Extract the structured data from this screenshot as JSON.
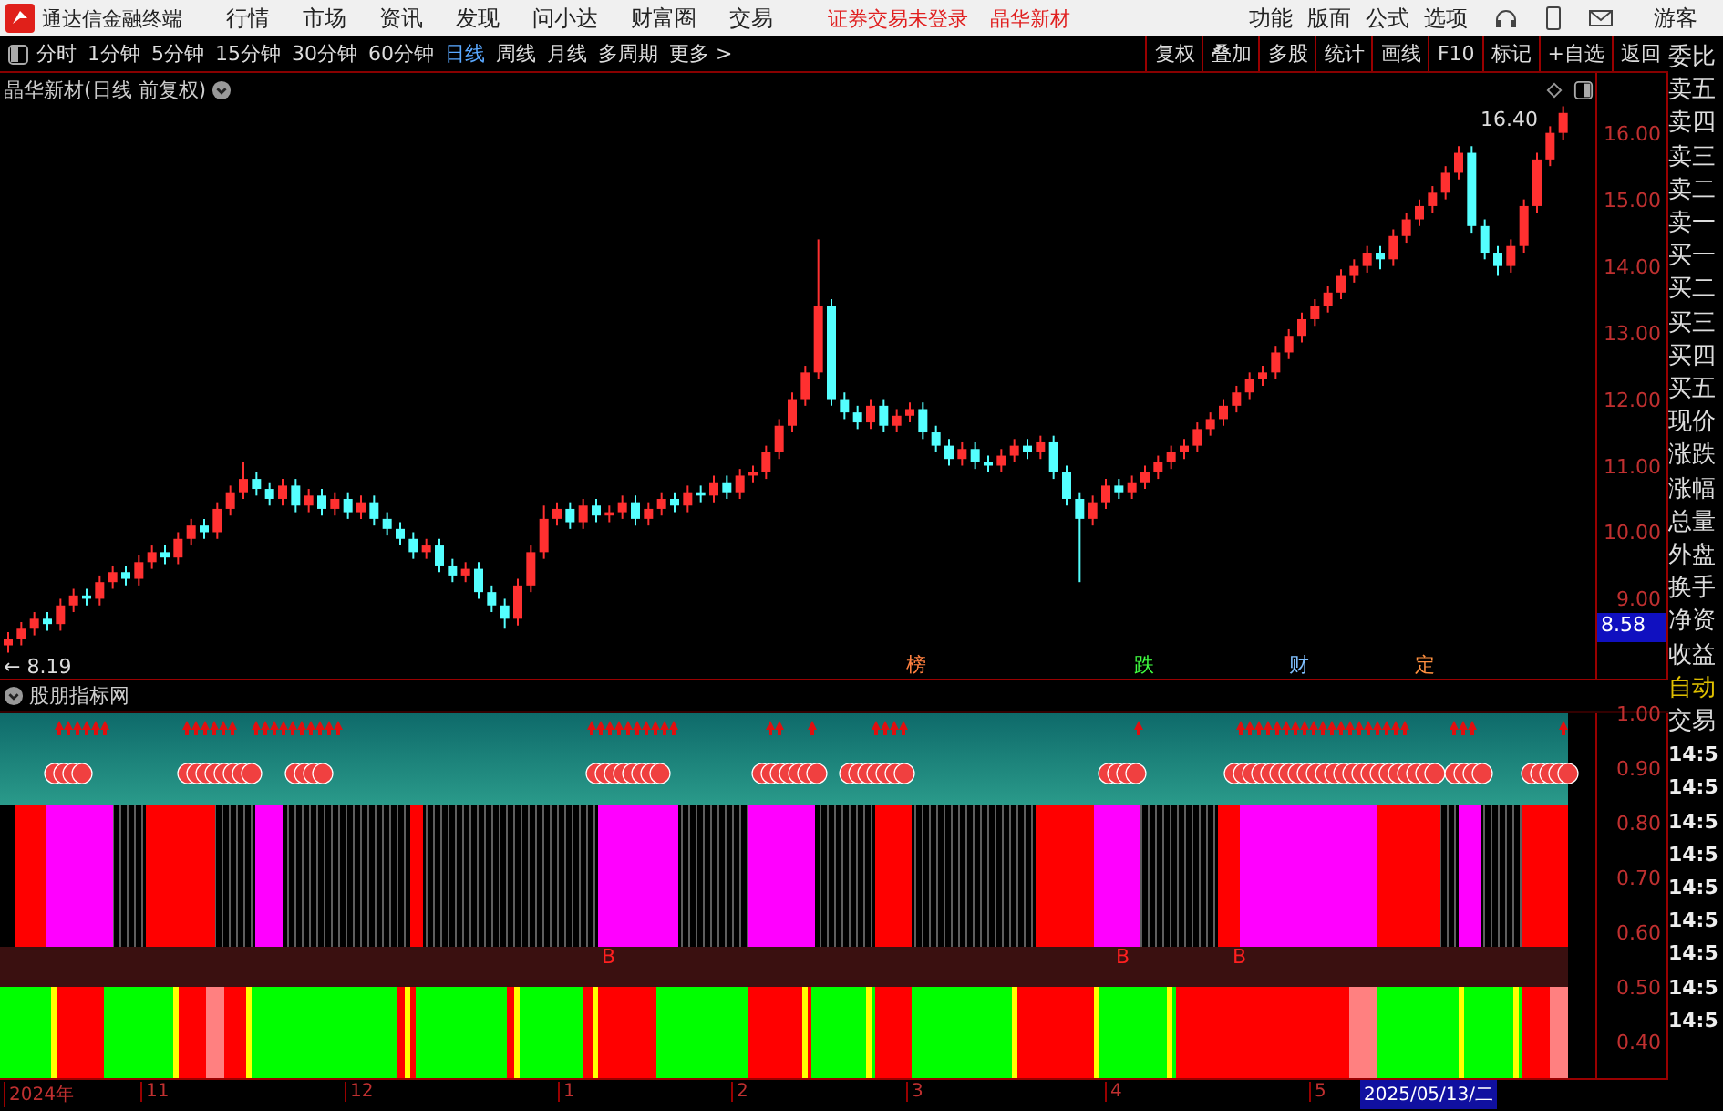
{
  "menu_bar": {
    "app_title": "通达信金融终端",
    "items": [
      "行情",
      "市场",
      "资讯",
      "发现",
      "问小达",
      "财富圈",
      "交易"
    ],
    "login_notice": "证券交易未登录",
    "stock_name": "晶华新材",
    "right_items": [
      "功能",
      "版面",
      "公式",
      "选项"
    ],
    "user": "游客"
  },
  "toolbar": {
    "periods": [
      {
        "label": "分时",
        "selected": false
      },
      {
        "label": "1分钟",
        "selected": false
      },
      {
        "label": "5分钟",
        "selected": false
      },
      {
        "label": "15分钟",
        "selected": false
      },
      {
        "label": "30分钟",
        "selected": false
      },
      {
        "label": "60分钟",
        "selected": false
      },
      {
        "label": "日线",
        "selected": true
      },
      {
        "label": "周线",
        "selected": false
      },
      {
        "label": "月线",
        "selected": false
      },
      {
        "label": "多周期",
        "selected": false
      },
      {
        "label": "更多 >",
        "selected": false
      }
    ],
    "buttons": [
      "复权",
      "叠加",
      "多股",
      "统计",
      "画线",
      "F10",
      "标记",
      "+自选",
      "返回"
    ]
  },
  "main_chart": {
    "title": "晶华新材(日线 前复权)",
    "high_label": "16.40",
    "low_label": "← 8.19",
    "cursor_value": "8.58",
    "chart_data": {
      "type": "candlestick",
      "ylim": [
        7.8,
        16.9
      ],
      "yticks": [
        {
          "value": 16,
          "label": "16.00"
        },
        {
          "value": 15,
          "label": "15.00"
        },
        {
          "value": 14,
          "label": "14.00"
        },
        {
          "value": 13,
          "label": "13.00"
        },
        {
          "value": 12,
          "label": "12.00"
        },
        {
          "value": 11,
          "label": "11.00"
        },
        {
          "value": 10,
          "label": "10.00"
        },
        {
          "value": 9,
          "label": "9.00"
        }
      ],
      "categories": [
        null,
        null,
        null,
        null,
        null,
        null,
        null,
        null,
        null,
        null,
        null,
        null,
        null,
        null,
        null,
        null,
        null,
        null,
        null,
        null,
        null,
        null,
        null,
        null,
        null,
        null,
        null,
        null,
        null,
        null,
        null,
        null,
        null,
        null,
        null,
        null,
        null,
        null,
        null,
        null,
        null,
        null,
        null,
        null,
        null,
        null,
        null,
        null,
        null,
        null,
        null,
        null,
        null,
        null,
        null,
        null,
        null,
        null,
        null,
        null,
        null,
        null,
        null,
        null,
        null,
        null,
        null,
        null,
        null,
        null,
        null,
        null,
        null,
        null,
        null,
        null,
        null,
        null,
        null,
        null,
        null,
        null,
        null,
        null,
        null,
        null,
        null,
        null,
        null,
        null,
        null,
        null,
        null,
        null,
        null,
        null,
        null,
        null,
        null,
        null,
        null,
        null,
        null,
        null,
        null,
        null,
        null,
        null,
        null,
        null,
        null,
        null,
        null,
        null,
        null,
        null,
        null,
        null,
        null,
        null
      ],
      "ohlc": [
        [
          8.3,
          8.5,
          8.19,
          8.4
        ],
        [
          8.4,
          8.65,
          8.3,
          8.55
        ],
        [
          8.55,
          8.8,
          8.45,
          8.7
        ],
        [
          8.7,
          8.8,
          8.52,
          8.62
        ],
        [
          8.62,
          9.0,
          8.52,
          8.9
        ],
        [
          8.9,
          9.15,
          8.8,
          9.05
        ],
        [
          9.05,
          9.15,
          8.9,
          9.0
        ],
        [
          9.0,
          9.35,
          8.9,
          9.25
        ],
        [
          9.25,
          9.5,
          9.15,
          9.4
        ],
        [
          9.4,
          9.5,
          9.2,
          9.3
        ],
        [
          9.3,
          9.65,
          9.2,
          9.55
        ],
        [
          9.55,
          9.8,
          9.45,
          9.7
        ],
        [
          9.7,
          9.8,
          9.52,
          9.62
        ],
        [
          9.62,
          10.0,
          9.52,
          9.9
        ],
        [
          9.9,
          10.2,
          9.8,
          10.1
        ],
        [
          10.1,
          10.2,
          9.9,
          10.0
        ],
        [
          10.0,
          10.45,
          9.9,
          10.35
        ],
        [
          10.35,
          10.7,
          10.25,
          10.6
        ],
        [
          10.6,
          11.05,
          10.5,
          10.8
        ],
        [
          10.8,
          10.9,
          10.55,
          10.65
        ],
        [
          10.65,
          10.75,
          10.4,
          10.5
        ],
        [
          10.5,
          10.8,
          10.4,
          10.7
        ],
        [
          10.7,
          10.8,
          10.3,
          10.4
        ],
        [
          10.4,
          10.65,
          10.3,
          10.55
        ],
        [
          10.55,
          10.65,
          10.25,
          10.35
        ],
        [
          10.35,
          10.6,
          10.25,
          10.5
        ],
        [
          10.5,
          10.6,
          10.2,
          10.3
        ],
        [
          10.3,
          10.55,
          10.2,
          10.45
        ],
        [
          10.45,
          10.55,
          10.1,
          10.2
        ],
        [
          10.2,
          10.3,
          9.95,
          10.05
        ],
        [
          10.05,
          10.15,
          9.8,
          9.9
        ],
        [
          9.9,
          10.0,
          9.6,
          9.7
        ],
        [
          9.7,
          9.9,
          9.6,
          9.8
        ],
        [
          9.8,
          9.9,
          9.4,
          9.5
        ],
        [
          9.5,
          9.6,
          9.25,
          9.35
        ],
        [
          9.35,
          9.55,
          9.25,
          9.45
        ],
        [
          9.45,
          9.55,
          9.0,
          9.1
        ],
        [
          9.1,
          9.2,
          8.8,
          8.9
        ],
        [
          8.9,
          9.0,
          8.55,
          8.7
        ],
        [
          8.7,
          9.3,
          8.6,
          9.2
        ],
        [
          9.2,
          9.8,
          9.1,
          9.7
        ],
        [
          9.7,
          10.4,
          9.6,
          10.2
        ],
        [
          10.2,
          10.45,
          10.1,
          10.35
        ],
        [
          10.35,
          10.45,
          10.05,
          10.15
        ],
        [
          10.15,
          10.5,
          10.05,
          10.4
        ],
        [
          10.4,
          10.5,
          10.15,
          10.25
        ],
        [
          10.25,
          10.4,
          10.15,
          10.3
        ],
        [
          10.3,
          10.55,
          10.2,
          10.45
        ],
        [
          10.45,
          10.55,
          10.1,
          10.2
        ],
        [
          10.2,
          10.45,
          10.1,
          10.35
        ],
        [
          10.35,
          10.6,
          10.25,
          10.5
        ],
        [
          10.5,
          10.6,
          10.3,
          10.4
        ],
        [
          10.4,
          10.7,
          10.3,
          10.6
        ],
        [
          10.6,
          10.7,
          10.45,
          10.55
        ],
        [
          10.55,
          10.85,
          10.45,
          10.75
        ],
        [
          10.75,
          10.85,
          10.5,
          10.6
        ],
        [
          10.6,
          10.95,
          10.5,
          10.85
        ],
        [
          10.85,
          11.0,
          10.75,
          10.9
        ],
        [
          10.9,
          11.3,
          10.8,
          11.2
        ],
        [
          11.2,
          11.7,
          11.1,
          11.6
        ],
        [
          11.6,
          12.1,
          11.5,
          12.0
        ],
        [
          12.0,
          12.5,
          11.9,
          12.4
        ],
        [
          12.4,
          14.4,
          12.3,
          13.4
        ],
        [
          13.4,
          13.5,
          11.9,
          12.0
        ],
        [
          12.0,
          12.1,
          11.7,
          11.8
        ],
        [
          11.8,
          11.9,
          11.55,
          11.65
        ],
        [
          11.65,
          12.0,
          11.55,
          11.9
        ],
        [
          11.9,
          12.0,
          11.5,
          11.6
        ],
        [
          11.6,
          11.85,
          11.5,
          11.75
        ],
        [
          11.75,
          11.95,
          11.65,
          11.85
        ],
        [
          11.85,
          11.95,
          11.4,
          11.5
        ],
        [
          11.5,
          11.6,
          11.2,
          11.3
        ],
        [
          11.3,
          11.4,
          11.0,
          11.1
        ],
        [
          11.1,
          11.35,
          11.0,
          11.25
        ],
        [
          11.25,
          11.35,
          10.95,
          11.05
        ],
        [
          11.05,
          11.15,
          10.9,
          11.0
        ],
        [
          11.0,
          11.25,
          10.9,
          11.15
        ],
        [
          11.15,
          11.4,
          11.05,
          11.3
        ],
        [
          11.3,
          11.4,
          11.1,
          11.2
        ],
        [
          11.2,
          11.45,
          11.1,
          11.35
        ],
        [
          11.35,
          11.45,
          10.8,
          10.9
        ],
        [
          10.9,
          11.0,
          10.4,
          10.5
        ],
        [
          10.5,
          10.6,
          9.25,
          10.2
        ],
        [
          10.2,
          10.55,
          10.1,
          10.45
        ],
        [
          10.45,
          10.8,
          10.35,
          10.7
        ],
        [
          10.7,
          10.8,
          10.5,
          10.6
        ],
        [
          10.6,
          10.85,
          10.5,
          10.75
        ],
        [
          10.75,
          11.0,
          10.65,
          10.9
        ],
        [
          10.9,
          11.15,
          10.8,
          11.05
        ],
        [
          11.05,
          11.3,
          10.95,
          11.2
        ],
        [
          11.2,
          11.4,
          11.1,
          11.3
        ],
        [
          11.3,
          11.65,
          11.2,
          11.55
        ],
        [
          11.55,
          11.8,
          11.45,
          11.7
        ],
        [
          11.7,
          12.0,
          11.6,
          11.9
        ],
        [
          11.9,
          12.2,
          11.8,
          12.1
        ],
        [
          12.1,
          12.4,
          12.0,
          12.3
        ],
        [
          12.3,
          12.5,
          12.2,
          12.4
        ],
        [
          12.4,
          12.8,
          12.3,
          12.7
        ],
        [
          12.7,
          13.05,
          12.6,
          12.95
        ],
        [
          12.95,
          13.3,
          12.85,
          13.2
        ],
        [
          13.2,
          13.5,
          13.1,
          13.4
        ],
        [
          13.4,
          13.7,
          13.3,
          13.6
        ],
        [
          13.6,
          13.95,
          13.5,
          13.85
        ],
        [
          13.85,
          14.1,
          13.75,
          14.0
        ],
        [
          14.0,
          14.3,
          13.9,
          14.2
        ],
        [
          14.2,
          14.3,
          13.95,
          14.1
        ],
        [
          14.1,
          14.55,
          14.0,
          14.45
        ],
        [
          14.45,
          14.8,
          14.35,
          14.7
        ],
        [
          14.7,
          15.0,
          14.6,
          14.9
        ],
        [
          14.9,
          15.2,
          14.8,
          15.1
        ],
        [
          15.1,
          15.5,
          15.0,
          15.4
        ],
        [
          15.4,
          15.8,
          15.3,
          15.7
        ],
        [
          15.7,
          15.8,
          14.5,
          14.6
        ],
        [
          14.6,
          14.7,
          14.1,
          14.2
        ],
        [
          14.2,
          14.3,
          13.85,
          14.0
        ],
        [
          14.0,
          14.4,
          13.9,
          14.3
        ],
        [
          14.3,
          15.0,
          14.2,
          14.9
        ],
        [
          14.9,
          15.7,
          14.8,
          15.6
        ],
        [
          15.6,
          16.1,
          15.5,
          16.0
        ],
        [
          16.0,
          16.4,
          15.9,
          16.3
        ]
      ]
    },
    "event_marks": [
      {
        "text": "榜",
        "color": "#ff8040"
      },
      {
        "text": "跌",
        "color": "#40ff40"
      },
      {
        "text": "财",
        "color": "#80c0ff"
      },
      {
        "text": "定",
        "color": "#ff9040"
      }
    ]
  },
  "indicator": {
    "title": "股朋指标网",
    "yticks": [
      "1.00",
      "0.90",
      "0.80",
      "0.70",
      "0.60",
      "0.50",
      "0.40"
    ],
    "b_marks": [
      "B",
      "B",
      "B"
    ]
  },
  "date_axis": [
    "2024年",
    "11",
    "12",
    "1",
    "2",
    "3",
    "4",
    "5"
  ],
  "date_cursor": "2025/05/13/二",
  "right_panel": [
    {
      "label": "委比",
      "kind": "label"
    },
    {
      "label": "卖五",
      "kind": "label"
    },
    {
      "label": "卖四",
      "kind": "label"
    },
    {
      "label": "卖三",
      "kind": "label"
    },
    {
      "label": "卖二",
      "kind": "label"
    },
    {
      "label": "卖一",
      "kind": "label"
    },
    {
      "label": "买一",
      "kind": "label"
    },
    {
      "label": "买二",
      "kind": "label"
    },
    {
      "label": "买三",
      "kind": "label"
    },
    {
      "label": "买四",
      "kind": "label"
    },
    {
      "label": "买五",
      "kind": "label"
    },
    {
      "label": "现价",
      "kind": "label"
    },
    {
      "label": "涨跌",
      "kind": "label"
    },
    {
      "label": "涨幅",
      "kind": "label"
    },
    {
      "label": "总量",
      "kind": "label"
    },
    {
      "label": "外盘",
      "kind": "label"
    },
    {
      "label": "换手",
      "kind": "label"
    },
    {
      "label": "净资",
      "kind": "label"
    },
    {
      "label": "收益",
      "kind": "label"
    },
    {
      "label": "自动",
      "kind": "highlight"
    },
    {
      "label": "交易",
      "kind": "label"
    },
    {
      "label": "14:5",
      "kind": "time"
    },
    {
      "label": "14:5",
      "kind": "time"
    },
    {
      "label": "14:5",
      "kind": "time"
    },
    {
      "label": "14:5",
      "kind": "time"
    },
    {
      "label": "14:5",
      "kind": "time"
    },
    {
      "label": "14:5",
      "kind": "time"
    },
    {
      "label": "14:5",
      "kind": "time"
    },
    {
      "label": "14:5",
      "kind": "time"
    },
    {
      "label": "14:5",
      "kind": "time"
    }
  ]
}
